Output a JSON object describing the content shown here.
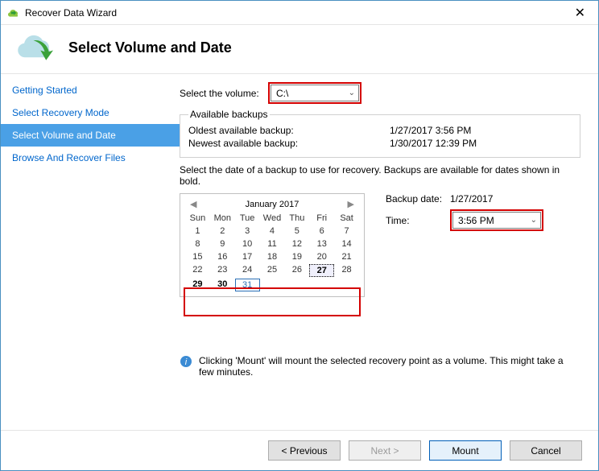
{
  "window": {
    "title": "Recover Data Wizard"
  },
  "header": {
    "title": "Select Volume and Date"
  },
  "sidebar": {
    "items": [
      {
        "label": "Getting Started"
      },
      {
        "label": "Select Recovery Mode"
      },
      {
        "label": "Select Volume and Date",
        "active": true
      },
      {
        "label": "Browse And Recover Files"
      }
    ]
  },
  "volume": {
    "label": "Select the volume:",
    "value": "C:\\"
  },
  "available": {
    "legend": "Available backups",
    "oldest_label": "Oldest available backup:",
    "oldest_value": "1/27/2017 3:56 PM",
    "newest_label": "Newest available backup:",
    "newest_value": "1/30/2017 12:39 PM"
  },
  "instruction": "Select the date of a backup to use for recovery. Backups are available for dates shown in bold.",
  "calendar": {
    "month": "January 2017",
    "dow": [
      "Sun",
      "Mon",
      "Tue",
      "Wed",
      "Thu",
      "Fri",
      "Sat"
    ],
    "weeks": [
      [
        {
          "n": "1",
          "s": "norm"
        },
        {
          "n": "2",
          "s": "norm"
        },
        {
          "n": "3",
          "s": "norm"
        },
        {
          "n": "4",
          "s": "norm"
        },
        {
          "n": "5",
          "s": "norm"
        },
        {
          "n": "6",
          "s": "norm"
        },
        {
          "n": "7",
          "s": "norm"
        }
      ],
      [
        {
          "n": "8",
          "s": "norm"
        },
        {
          "n": "9",
          "s": "norm"
        },
        {
          "n": "10",
          "s": "norm"
        },
        {
          "n": "11",
          "s": "norm"
        },
        {
          "n": "12",
          "s": "norm"
        },
        {
          "n": "13",
          "s": "norm"
        },
        {
          "n": "14",
          "s": "norm"
        }
      ],
      [
        {
          "n": "15",
          "s": "norm"
        },
        {
          "n": "16",
          "s": "norm"
        },
        {
          "n": "17",
          "s": "norm"
        },
        {
          "n": "18",
          "s": "norm"
        },
        {
          "n": "19",
          "s": "norm"
        },
        {
          "n": "20",
          "s": "norm"
        },
        {
          "n": "21",
          "s": "norm"
        }
      ],
      [
        {
          "n": "22",
          "s": "norm"
        },
        {
          "n": "23",
          "s": "norm"
        },
        {
          "n": "24",
          "s": "norm"
        },
        {
          "n": "25",
          "s": "norm"
        },
        {
          "n": "26",
          "s": "norm"
        },
        {
          "n": "27",
          "s": "sel"
        },
        {
          "n": "28",
          "s": "norm"
        }
      ],
      [
        {
          "n": "29",
          "s": "bold"
        },
        {
          "n": "30",
          "s": "bold"
        },
        {
          "n": "31",
          "s": "today"
        },
        {
          "n": "",
          "s": "dim"
        },
        {
          "n": "",
          "s": "dim"
        },
        {
          "n": "",
          "s": "dim"
        },
        {
          "n": "",
          "s": "dim"
        }
      ]
    ]
  },
  "backup_date": {
    "label": "Backup date:",
    "value": "1/27/2017"
  },
  "time": {
    "label": "Time:",
    "value": "3:56 PM"
  },
  "info": "Clicking 'Mount' will mount the selected recovery point as a volume. This might take a few minutes.",
  "buttons": {
    "previous": "< Previous",
    "next": "Next >",
    "mount": "Mount",
    "cancel": "Cancel"
  }
}
